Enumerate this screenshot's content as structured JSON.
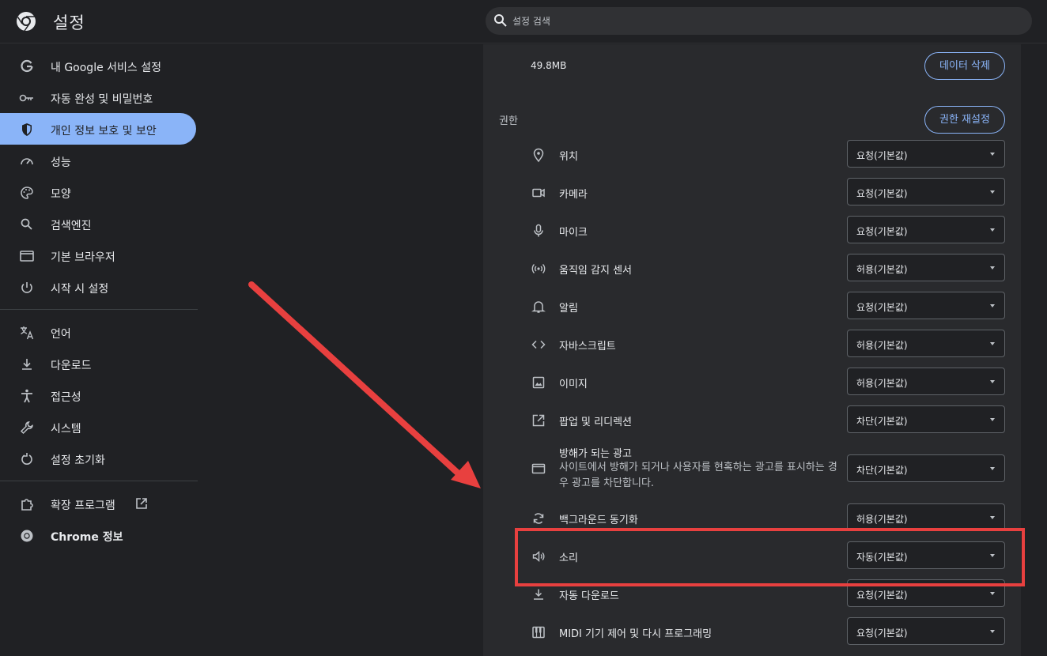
{
  "header": {
    "title": "설정",
    "search_placeholder": "설정 검색"
  },
  "sidebar": {
    "items": [
      {
        "label": "내 Google 서비스 설정",
        "icon": "google-g-icon"
      },
      {
        "label": "자동 완성 및 비밀번호",
        "icon": "key-icon"
      },
      {
        "label": "개인 정보 보호 및 보안",
        "icon": "shield-icon",
        "active": true
      },
      {
        "label": "성능",
        "icon": "speedometer-icon"
      },
      {
        "label": "모양",
        "icon": "palette-icon"
      },
      {
        "label": "검색엔진",
        "icon": "search-icon"
      },
      {
        "label": "기본 브라우저",
        "icon": "browser-window-icon"
      },
      {
        "label": "시작 시 설정",
        "icon": "power-icon"
      },
      {
        "label": "언어",
        "icon": "translate-icon"
      },
      {
        "label": "다운로드",
        "icon": "download-icon"
      },
      {
        "label": "접근성",
        "icon": "accessibility-icon"
      },
      {
        "label": "시스템",
        "icon": "wrench-icon"
      },
      {
        "label": "설정 초기화",
        "icon": "reset-icon"
      },
      {
        "label": "확장 프로그램",
        "icon": "puzzle-icon"
      },
      {
        "label": "Chrome 정보",
        "icon": "chrome-icon"
      }
    ]
  },
  "main": {
    "storage_value": "49.8MB",
    "clear_data_button": "데이터 삭제",
    "permissions_title": "권한",
    "reset_permissions_button": "권한 재설정",
    "permissions": [
      {
        "label": "위치",
        "icon": "location-pin-icon",
        "value": "요청(기본값)"
      },
      {
        "label": "카메라",
        "icon": "camera-icon",
        "value": "요청(기본값)"
      },
      {
        "label": "마이크",
        "icon": "microphone-icon",
        "value": "요청(기본값)"
      },
      {
        "label": "움직임 감지 센서",
        "icon": "sensors-icon",
        "value": "허용(기본값)"
      },
      {
        "label": "알림",
        "icon": "bell-icon",
        "value": "요청(기본값)"
      },
      {
        "label": "자바스크립트",
        "icon": "code-icon",
        "value": "허용(기본값)"
      },
      {
        "label": "이미지",
        "icon": "image-icon",
        "value": "허용(기본값)"
      },
      {
        "label": "팝업 및 리디렉션",
        "icon": "popup-icon",
        "value": "차단(기본값)"
      },
      {
        "label": "방해가 되는 광고",
        "icon": "ads-icon",
        "value": "차단(기본값)",
        "desc": "사이트에서 방해가 되거나 사용자를 현혹하는 광고를 표시하는 경우 광고를 차단합니다."
      },
      {
        "label": "백그라운드 동기화",
        "icon": "sync-icon",
        "value": "허용(기본값)"
      },
      {
        "label": "소리",
        "icon": "speaker-icon",
        "value": "자동(기본값)"
      },
      {
        "label": "자동 다운로드",
        "icon": "download-icon",
        "value": "요청(기본값)"
      },
      {
        "label": "MIDI 기기 제어 및 다시 프로그래밍",
        "icon": "piano-icon",
        "value": "요청(기본값)"
      }
    ]
  },
  "annotation": {
    "arrow_color": "#e8403f",
    "highlight_color": "#e8403f"
  }
}
